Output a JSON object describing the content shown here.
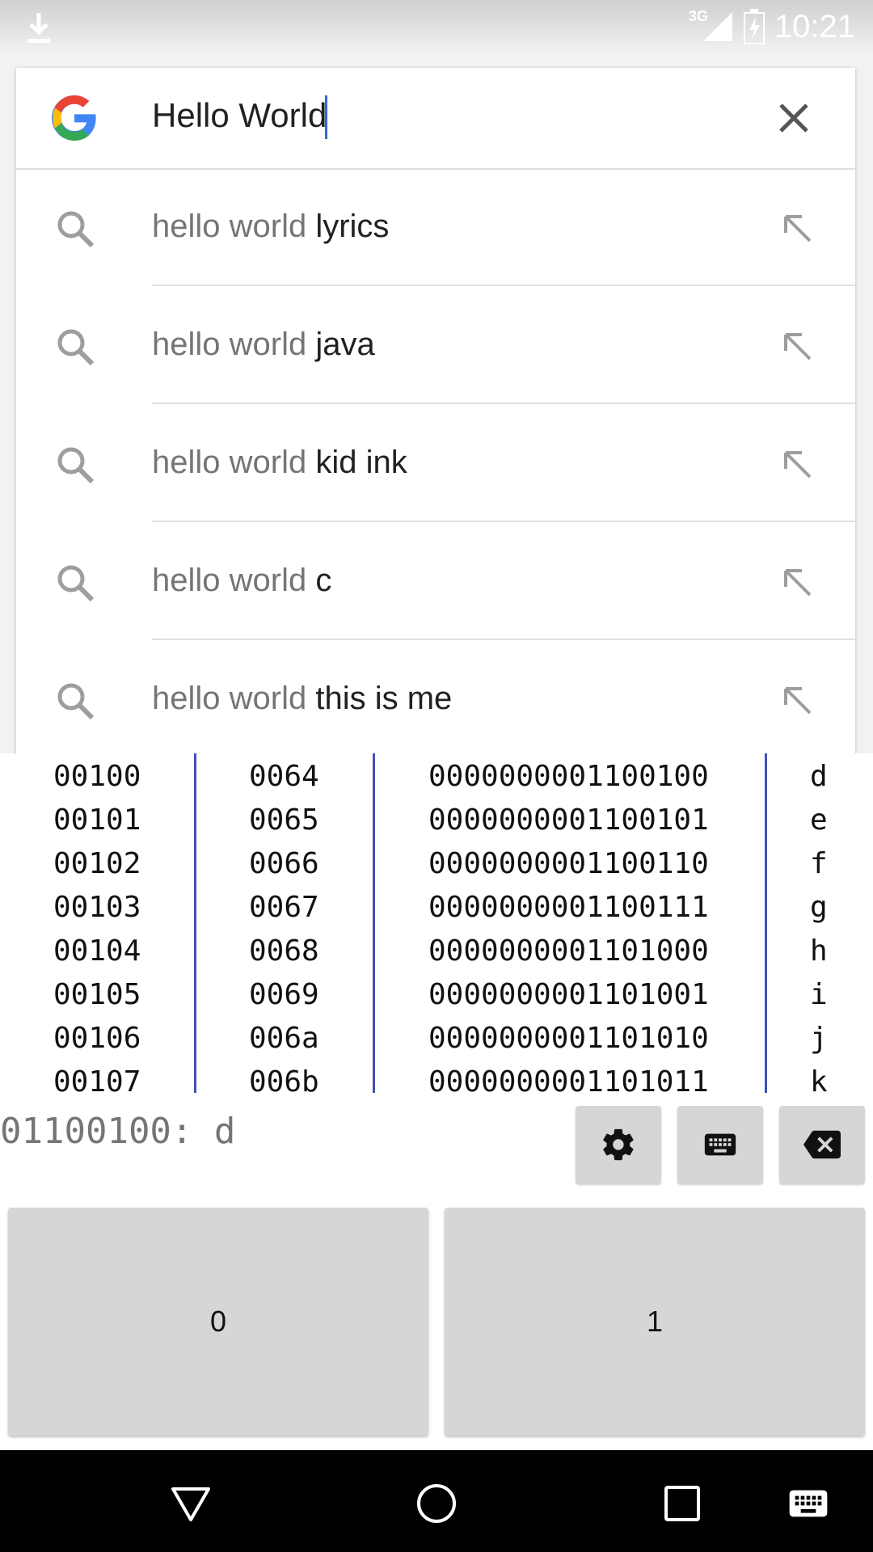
{
  "status_bar": {
    "time": "10:21",
    "network": "3G",
    "icons": [
      "download-icon",
      "signal-icon",
      "battery-icon"
    ]
  },
  "search": {
    "query": "Hello World",
    "clear_icon": "close-icon",
    "logo": "google-logo"
  },
  "suggestions": [
    {
      "prefix": "hello world ",
      "completion": "lyrics"
    },
    {
      "prefix": "hello world ",
      "completion": "java"
    },
    {
      "prefix": "hello world ",
      "completion": "kid ink"
    },
    {
      "prefix": "hello world ",
      "completion": "c"
    },
    {
      "prefix": "hello world ",
      "completion": "this is me"
    }
  ],
  "code_table": [
    [
      "00100",
      "0064",
      "0000000001100100",
      "d"
    ],
    [
      "00101",
      "0065",
      "0000000001100101",
      "e"
    ],
    [
      "00102",
      "0066",
      "0000000001100110",
      "f"
    ],
    [
      "00103",
      "0067",
      "0000000001100111",
      "g"
    ],
    [
      "00104",
      "0068",
      "0000000001101000",
      "h"
    ],
    [
      "00105",
      "0069",
      "0000000001101001",
      "i"
    ],
    [
      "00106",
      "006a",
      "0000000001101010",
      "j"
    ],
    [
      "00107",
      "006b",
      "0000000001101011",
      "k"
    ]
  ],
  "keyboard": {
    "display": "01100100: d",
    "key_zero": "0",
    "key_one": "1",
    "function_keys": [
      "settings-icon",
      "keyboard-icon",
      "backspace-icon"
    ]
  },
  "colors": {
    "accent": "#3f51b5",
    "cursor": "#3367d6",
    "key": "#d6d6d6"
  }
}
